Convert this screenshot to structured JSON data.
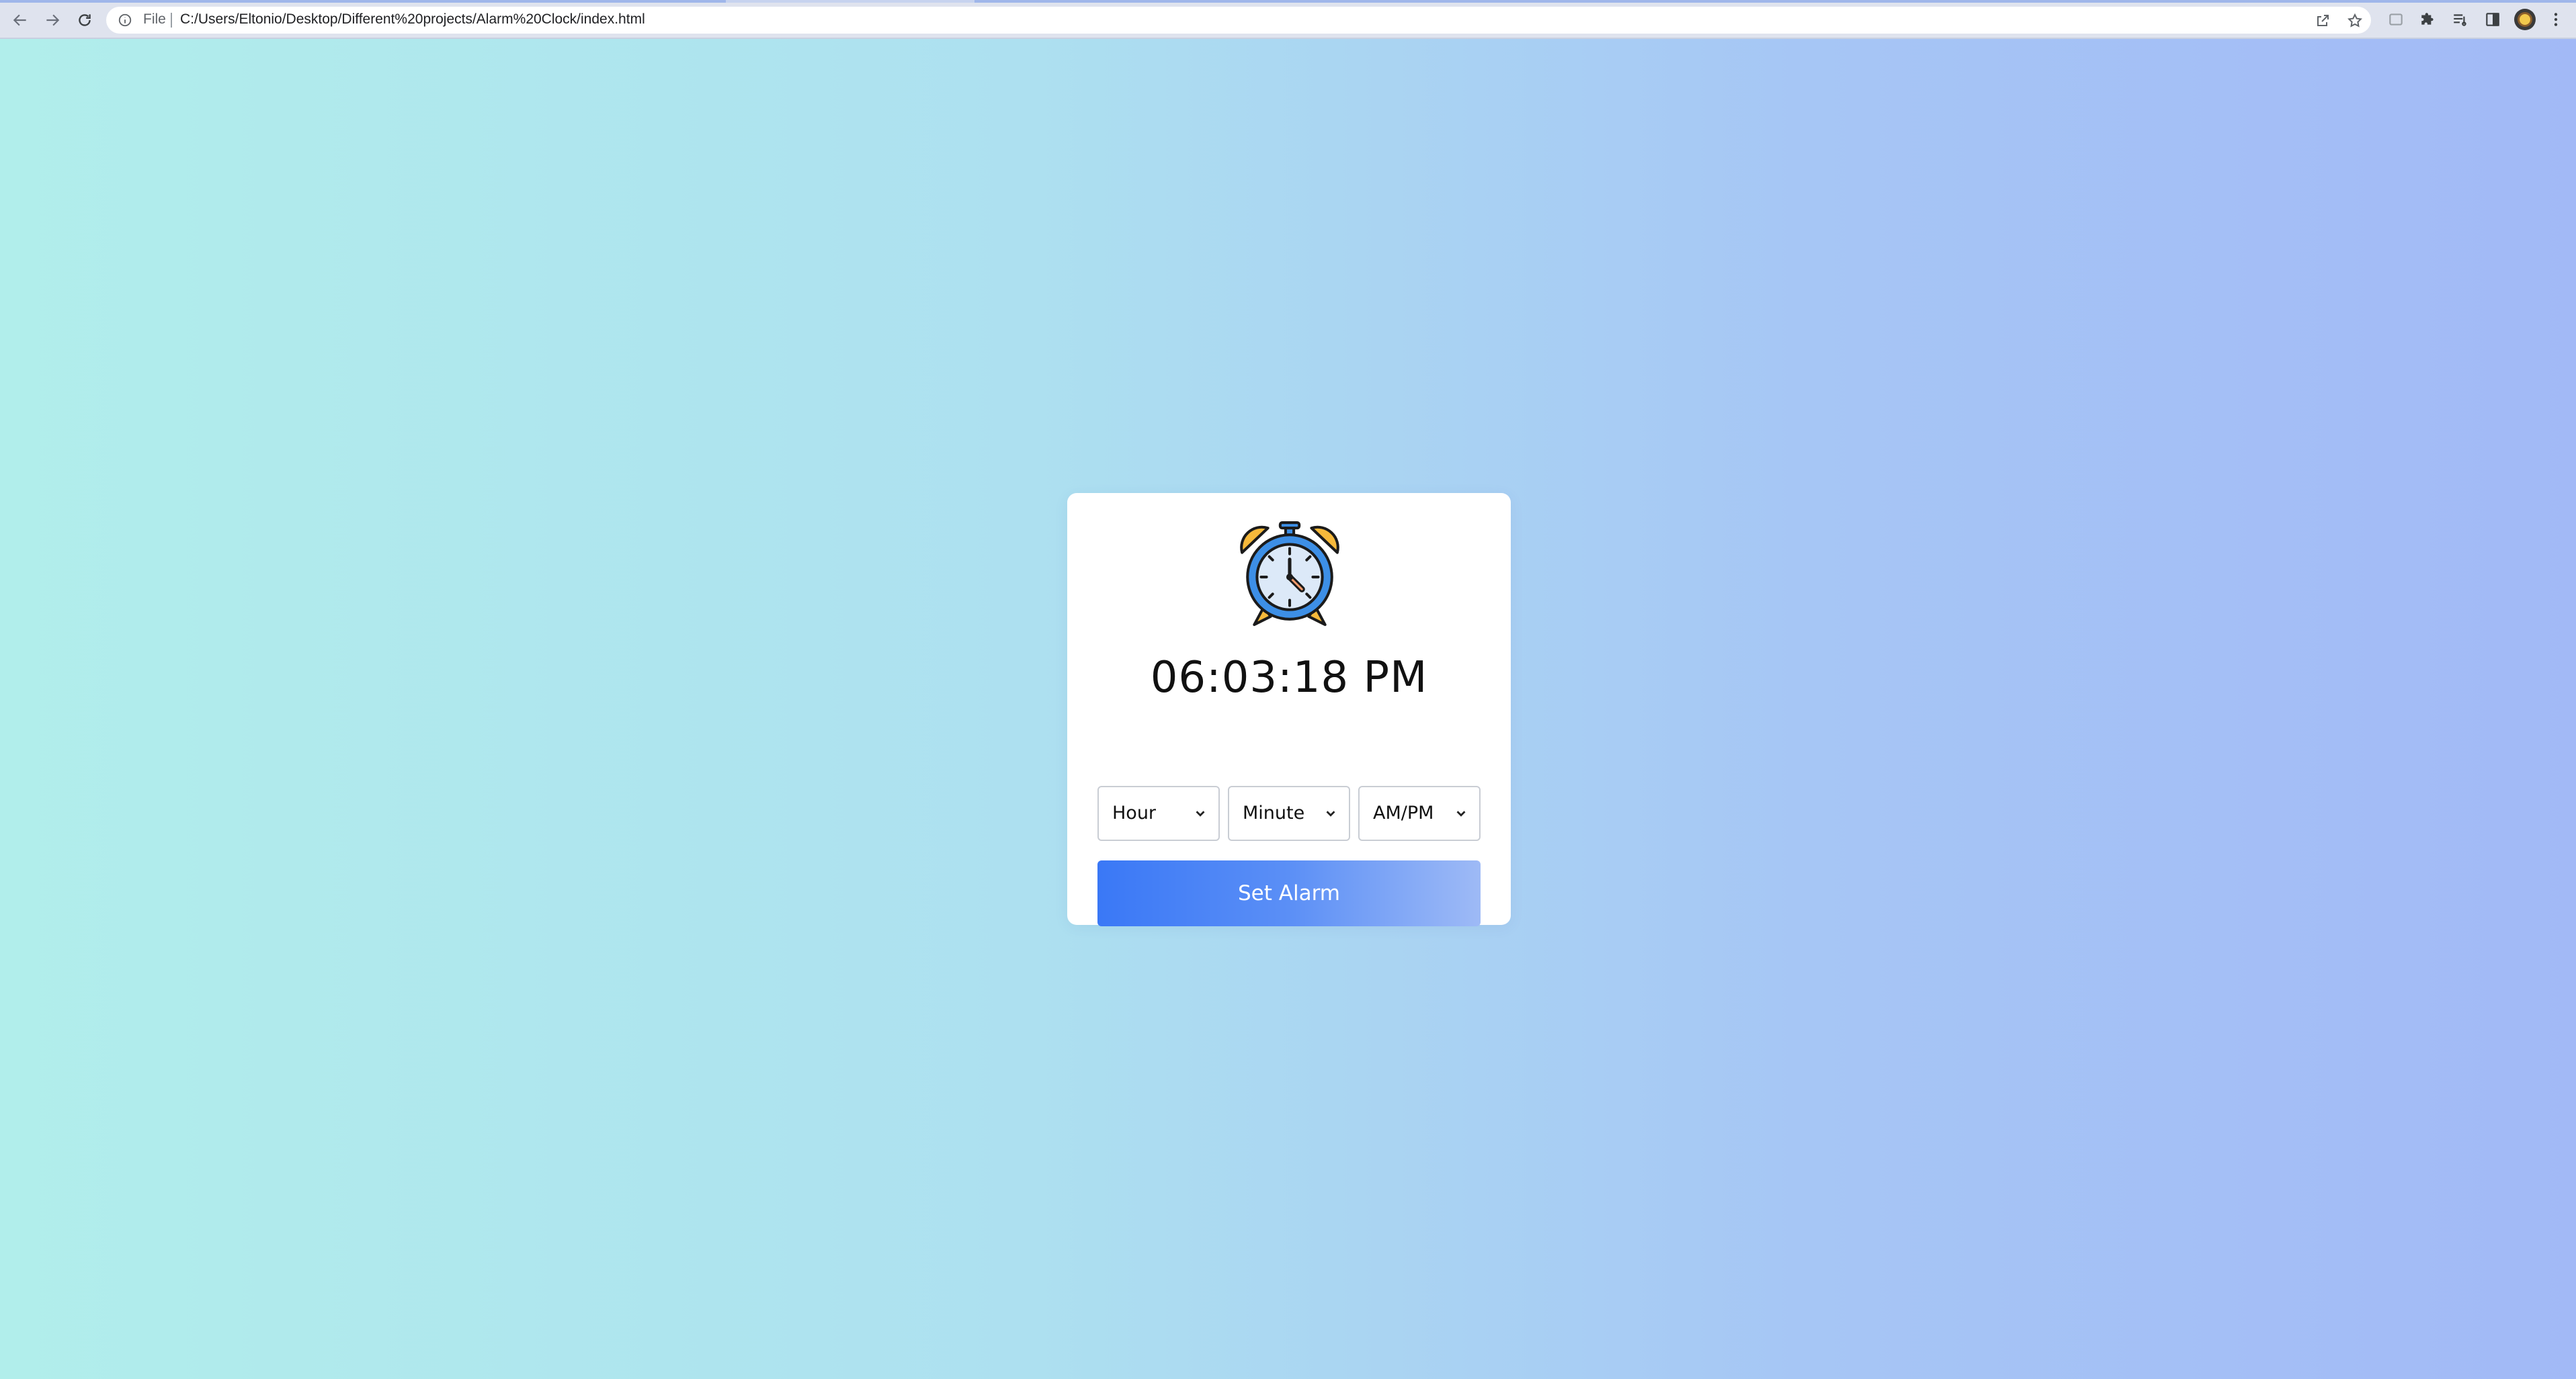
{
  "browser": {
    "scheme_label": "File",
    "url": "C:/Users/Eltonio/Desktop/Different%20projects/Alarm%20Clock/index.html",
    "icons": {
      "back": "arrow-left-icon",
      "forward": "arrow-right-icon",
      "reload": "reload-icon",
      "site_info": "info-icon",
      "share": "share-icon",
      "bookmark": "star-icon",
      "screenshot": "capture-icon",
      "extensions": "puzzle-icon",
      "reading_list": "reading-list-icon",
      "side_panel": "side-panel-icon",
      "profile": "avatar",
      "menu": "kebab-menu-icon"
    }
  },
  "app": {
    "clock_icon": "alarm-clock-icon",
    "current_time": "06:03:18 PM",
    "selects": {
      "hour": "Hour",
      "minute": "Minute",
      "ampm": "AM/PM"
    },
    "set_alarm_label": "Set Alarm"
  },
  "colors": {
    "background_start": "#b1eeeb",
    "background_end": "#a2b9f6",
    "button_start": "#3a78f6",
    "button_end": "#9ebaf6",
    "clock_blue": "#3d8fe6",
    "clock_bells": "#f6b93b"
  }
}
